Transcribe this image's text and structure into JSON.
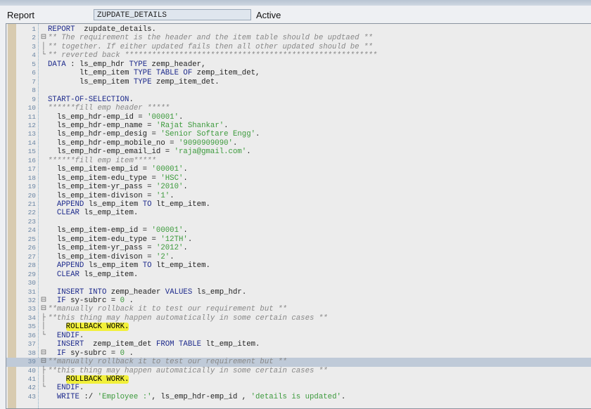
{
  "header": {
    "report_label": "Report",
    "program_name": "ZUPDATE_DETAILS",
    "status": "Active"
  },
  "colors": {
    "keyword": "#1d2a8c",
    "string": "#3c9a3c",
    "comment": "#888888",
    "highlight": "#f2f03a",
    "current_line": "#bfcad8"
  },
  "editor": {
    "current_line": 39,
    "lines": [
      {
        "n": "1",
        "f": "",
        "t": [
          [
            "kw",
            "REPORT"
          ],
          [
            "txt",
            "  zupdate_details."
          ]
        ]
      },
      {
        "n": "2",
        "f": "⊟",
        "t": [
          [
            "cmt",
            "** The requirement is the header and the item table should be updtaed **"
          ]
        ]
      },
      {
        "n": "3",
        "f": "│",
        "t": [
          [
            "cmt",
            "** together. If either updated fails then all other updated should be **"
          ]
        ]
      },
      {
        "n": "4",
        "f": "└",
        "t": [
          [
            "cmt",
            "** reverted back ********************************************************"
          ]
        ]
      },
      {
        "n": "5",
        "f": "",
        "t": [
          [
            "kw",
            "DATA"
          ],
          [
            "txt",
            " : ls_emp_hdr "
          ],
          [
            "kw",
            "TYPE"
          ],
          [
            "txt",
            " zemp_header,"
          ]
        ]
      },
      {
        "n": "6",
        "f": "",
        "t": [
          [
            "txt",
            "       lt_emp_item "
          ],
          [
            "kw",
            "TYPE TABLE OF"
          ],
          [
            "txt",
            " zemp_item_det,"
          ]
        ]
      },
      {
        "n": "7",
        "f": "",
        "t": [
          [
            "txt",
            "       ls_emp_item "
          ],
          [
            "kw",
            "TYPE"
          ],
          [
            "txt",
            " zemp_item_det."
          ]
        ]
      },
      {
        "n": "8",
        "f": "",
        "t": []
      },
      {
        "n": "9",
        "f": "",
        "t": [
          [
            "kw",
            "START-OF-SELECTION"
          ],
          [
            "txt",
            "."
          ]
        ]
      },
      {
        "n": "10",
        "f": "",
        "t": [
          [
            "cmt",
            "******fill emp header *****"
          ]
        ]
      },
      {
        "n": "11",
        "f": "",
        "t": [
          [
            "txt",
            "  ls_emp_hdr-emp_id = "
          ],
          [
            "str",
            "'00001'"
          ],
          [
            "txt",
            "."
          ]
        ]
      },
      {
        "n": "12",
        "f": "",
        "t": [
          [
            "txt",
            "  ls_emp_hdr-emp_name = "
          ],
          [
            "str",
            "'Rajat Shankar'"
          ],
          [
            "txt",
            "."
          ]
        ]
      },
      {
        "n": "13",
        "f": "",
        "t": [
          [
            "txt",
            "  ls_emp_hdr-emp_desig = "
          ],
          [
            "str",
            "'Senior Softare Engg'"
          ],
          [
            "txt",
            "."
          ]
        ]
      },
      {
        "n": "14",
        "f": "",
        "t": [
          [
            "txt",
            "  ls_emp_hdr-emp_mobile_no = "
          ],
          [
            "str",
            "'9090909090'"
          ],
          [
            "txt",
            "."
          ]
        ]
      },
      {
        "n": "15",
        "f": "",
        "t": [
          [
            "txt",
            "  ls_emp_hdr-emp_email_id = "
          ],
          [
            "str",
            "'raja@gmail.com'"
          ],
          [
            "txt",
            "."
          ]
        ]
      },
      {
        "n": "16",
        "f": "",
        "t": [
          [
            "cmt",
            "******fill emp item*****"
          ]
        ]
      },
      {
        "n": "17",
        "f": "",
        "t": [
          [
            "txt",
            "  ls_emp_item-emp_id = "
          ],
          [
            "str",
            "'00001'"
          ],
          [
            "txt",
            "."
          ]
        ]
      },
      {
        "n": "18",
        "f": "",
        "t": [
          [
            "txt",
            "  ls_emp_item-edu_type = "
          ],
          [
            "str",
            "'HSC'"
          ],
          [
            "txt",
            "."
          ]
        ]
      },
      {
        "n": "19",
        "f": "",
        "t": [
          [
            "txt",
            "  ls_emp_item-yr_pass = "
          ],
          [
            "str",
            "'2010'"
          ],
          [
            "txt",
            "."
          ]
        ]
      },
      {
        "n": "20",
        "f": "",
        "t": [
          [
            "txt",
            "  ls_emp_item-divison = "
          ],
          [
            "str",
            "'1'"
          ],
          [
            "txt",
            "."
          ]
        ]
      },
      {
        "n": "21",
        "f": "",
        "t": [
          [
            "txt",
            "  "
          ],
          [
            "kw",
            "APPEND"
          ],
          [
            "txt",
            " ls_emp_item "
          ],
          [
            "kw",
            "TO"
          ],
          [
            "txt",
            " lt_emp_item."
          ]
        ]
      },
      {
        "n": "22",
        "f": "",
        "t": [
          [
            "txt",
            "  "
          ],
          [
            "kw",
            "CLEAR"
          ],
          [
            "txt",
            " ls_emp_item."
          ]
        ]
      },
      {
        "n": "23",
        "f": "",
        "t": []
      },
      {
        "n": "24",
        "f": "",
        "t": [
          [
            "txt",
            "  ls_emp_item-emp_id = "
          ],
          [
            "str",
            "'00001'"
          ],
          [
            "txt",
            "."
          ]
        ]
      },
      {
        "n": "25",
        "f": "",
        "t": [
          [
            "txt",
            "  ls_emp_item-edu_type = "
          ],
          [
            "str",
            "'12TH'"
          ],
          [
            "txt",
            "."
          ]
        ]
      },
      {
        "n": "26",
        "f": "",
        "t": [
          [
            "txt",
            "  ls_emp_item-yr_pass = "
          ],
          [
            "str",
            "'2012'"
          ],
          [
            "txt",
            "."
          ]
        ]
      },
      {
        "n": "27",
        "f": "",
        "t": [
          [
            "txt",
            "  ls_emp_item-divison = "
          ],
          [
            "str",
            "'2'"
          ],
          [
            "txt",
            "."
          ]
        ]
      },
      {
        "n": "28",
        "f": "",
        "t": [
          [
            "txt",
            "  "
          ],
          [
            "kw",
            "APPEND"
          ],
          [
            "txt",
            " ls_emp_item "
          ],
          [
            "kw",
            "TO"
          ],
          [
            "txt",
            " lt_emp_item."
          ]
        ]
      },
      {
        "n": "29",
        "f": "",
        "t": [
          [
            "txt",
            "  "
          ],
          [
            "kw",
            "CLEAR"
          ],
          [
            "txt",
            " ls_emp_item."
          ]
        ]
      },
      {
        "n": "30",
        "f": "",
        "t": []
      },
      {
        "n": "31",
        "f": "",
        "t": [
          [
            "txt",
            "  "
          ],
          [
            "kw",
            "INSERT INTO"
          ],
          [
            "txt",
            " zemp_header "
          ],
          [
            "kw",
            "VALUES"
          ],
          [
            "txt",
            " ls_emp_hdr."
          ]
        ]
      },
      {
        "n": "32",
        "f": "⊟",
        "t": [
          [
            "txt",
            "  "
          ],
          [
            "kw",
            "IF"
          ],
          [
            "txt",
            " sy-subrc = "
          ],
          [
            "str",
            "0"
          ],
          [
            "txt",
            " ."
          ]
        ]
      },
      {
        "n": "33",
        "f": "⊟",
        "t": [
          [
            "cmt",
            "**manually rollback it to test our requirement but **"
          ]
        ]
      },
      {
        "n": "34",
        "f": "├",
        "t": [
          [
            "cmt",
            "**this thing may happen automatically in some certain cases **"
          ]
        ]
      },
      {
        "n": "35",
        "f": "│",
        "t": [
          [
            "txt",
            "    "
          ],
          [
            "hl",
            "ROLLBACK WORK."
          ]
        ]
      },
      {
        "n": "36",
        "f": "└",
        "t": [
          [
            "txt",
            "  "
          ],
          [
            "kw",
            "ENDIF"
          ],
          [
            "txt",
            "."
          ]
        ]
      },
      {
        "n": "37",
        "f": "",
        "t": [
          [
            "txt",
            "  "
          ],
          [
            "kw",
            "INSERT"
          ],
          [
            "txt",
            "  zemp_item_det "
          ],
          [
            "kw",
            "FROM TABLE"
          ],
          [
            "txt",
            " lt_emp_item."
          ]
        ]
      },
      {
        "n": "38",
        "f": "⊟",
        "t": [
          [
            "txt",
            "  "
          ],
          [
            "kw",
            "IF"
          ],
          [
            "txt",
            " sy-subrc = "
          ],
          [
            "str",
            "0"
          ],
          [
            "txt",
            " ."
          ]
        ]
      },
      {
        "n": "39",
        "f": "⊟",
        "t": [
          [
            "cmt",
            "**manually rollback it to test our requirement but **"
          ]
        ]
      },
      {
        "n": "40",
        "f": "├",
        "t": [
          [
            "cmt",
            "**this thing may happen automatically in some certain cases **"
          ]
        ]
      },
      {
        "n": "41",
        "f": "│",
        "t": [
          [
            "txt",
            "    "
          ],
          [
            "hl",
            "ROLLBACK WORK."
          ]
        ]
      },
      {
        "n": "42",
        "f": "└",
        "t": [
          [
            "txt",
            "  "
          ],
          [
            "kw",
            "ENDIF"
          ],
          [
            "txt",
            "."
          ]
        ]
      },
      {
        "n": "43",
        "f": "",
        "t": [
          [
            "txt",
            "  "
          ],
          [
            "kw",
            "WRITE"
          ],
          [
            "txt",
            " :/ "
          ],
          [
            "str",
            "'Employee :'"
          ],
          [
            "txt",
            ", ls_emp_hdr-emp_id , "
          ],
          [
            "str",
            "'details is updated'"
          ],
          [
            "txt",
            "."
          ]
        ]
      }
    ]
  }
}
